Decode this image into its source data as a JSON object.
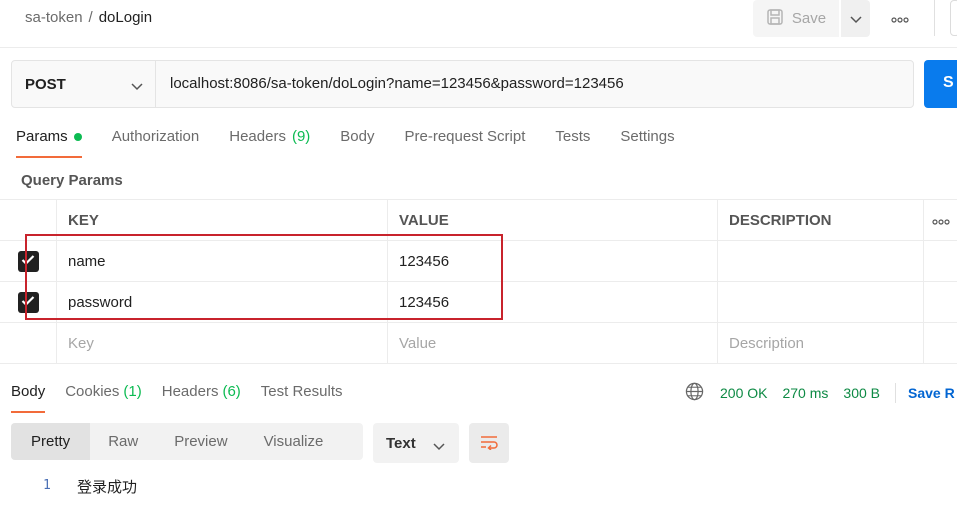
{
  "breadcrumb": {
    "parent": "sa-token",
    "separator": "/",
    "current": "doLogin"
  },
  "toolbar": {
    "save_label": "Save"
  },
  "request": {
    "method": "POST",
    "url": "localhost:8086/sa-token/doLogin?name=123456&password=123456",
    "send_label": "S"
  },
  "tabs": {
    "params": "Params",
    "authorization": "Authorization",
    "headers": "Headers",
    "headers_count": "(9)",
    "body": "Body",
    "prerequest": "Pre-request Script",
    "tests": "Tests",
    "settings": "Settings"
  },
  "query_params": {
    "title": "Query Params",
    "headers": {
      "key": "KEY",
      "value": "VALUE",
      "description": "DESCRIPTION"
    },
    "rows": [
      {
        "key": "name",
        "value": "123456",
        "checked": true
      },
      {
        "key": "password",
        "value": "123456",
        "checked": true
      }
    ],
    "placeholder": {
      "key": "Key",
      "value": "Value",
      "description": "Description"
    }
  },
  "response": {
    "tabs": {
      "body": "Body",
      "cookies": "Cookies",
      "cookies_count": "(1)",
      "headers": "Headers",
      "headers_count": "(6)",
      "test_results": "Test Results"
    },
    "status": "200 OK",
    "time": "270 ms",
    "size": "300 B",
    "save_label": "Save R",
    "view_modes": [
      "Pretty",
      "Raw",
      "Preview",
      "Visualize"
    ],
    "format": "Text",
    "lines": [
      {
        "num": "1",
        "text": "登录成功"
      }
    ]
  },
  "colors": {
    "accent": "#f26b3a",
    "success": "#0cbb52",
    "send": "#097bed",
    "highlight": "#c8232c"
  }
}
